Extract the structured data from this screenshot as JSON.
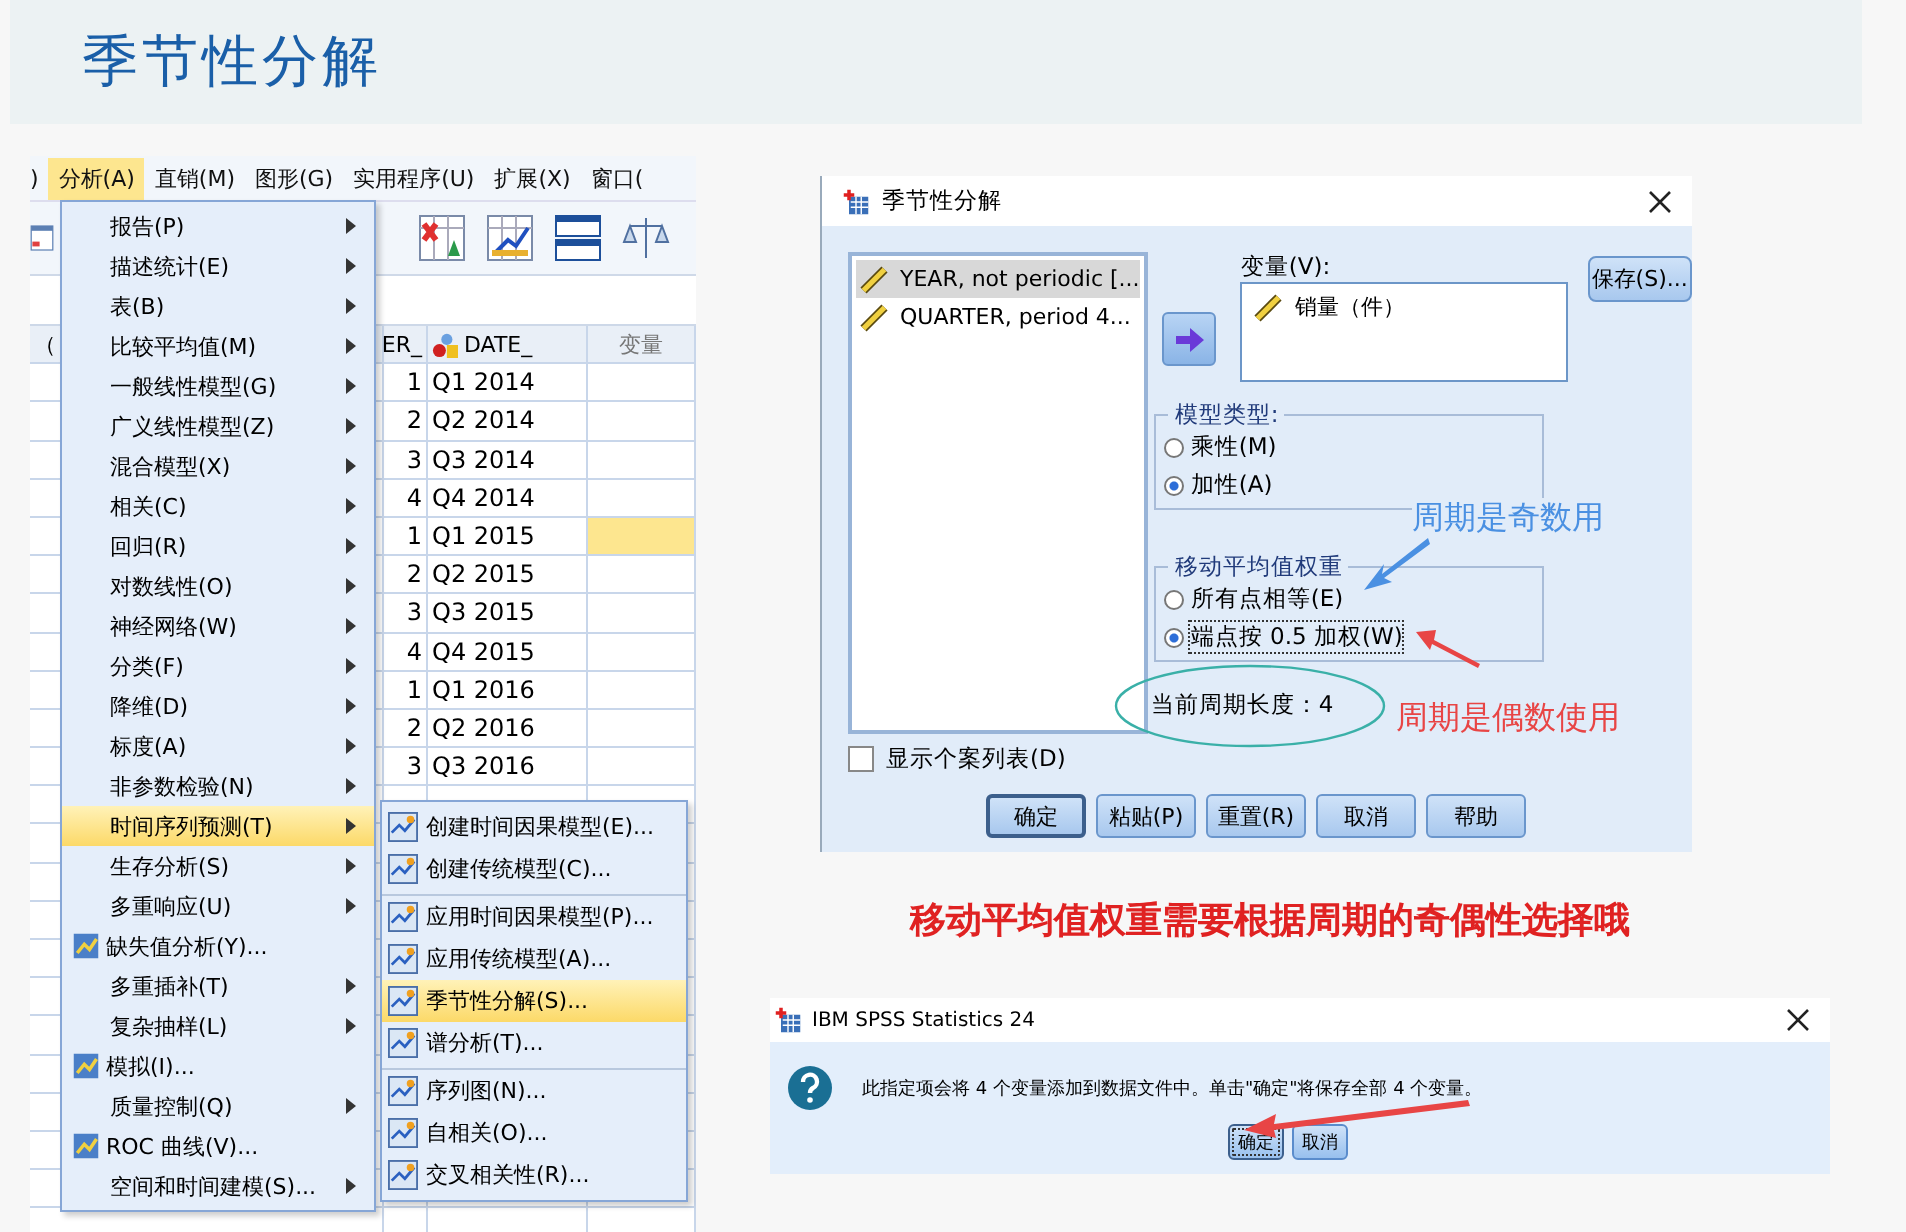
{
  "page": {
    "title": "季节性分解"
  },
  "spss": {
    "menu_bar": [
      {
        "label": ")",
        "selected": false
      },
      {
        "label": "分析(A)",
        "selected": true
      },
      {
        "label": "直销(M)",
        "selected": false
      },
      {
        "label": "图形(G)",
        "selected": false
      },
      {
        "label": "实用程序(U)",
        "selected": false
      },
      {
        "label": "扩展(X)",
        "selected": false
      },
      {
        "label": "窗口(",
        "selected": false
      }
    ],
    "columns": [
      "（",
      "ER_",
      "DATE_",
      "变量"
    ],
    "rows": [
      {
        "period": "1",
        "date": "Q1 2014",
        "selected": false
      },
      {
        "period": "2",
        "date": "Q2 2014",
        "selected": false
      },
      {
        "period": "3",
        "date": "Q3 2014",
        "selected": false
      },
      {
        "period": "4",
        "date": "Q4 2014",
        "selected": false
      },
      {
        "period": "1",
        "date": "Q1 2015",
        "selected": true
      },
      {
        "period": "2",
        "date": "Q2 2015",
        "selected": false
      },
      {
        "period": "3",
        "date": "Q3 2015",
        "selected": false
      },
      {
        "period": "4",
        "date": "Q4 2015",
        "selected": false
      },
      {
        "period": "1",
        "date": "Q1 2016",
        "selected": false
      },
      {
        "period": "2",
        "date": "Q2 2016",
        "selected": false
      },
      {
        "period": "3",
        "date": "Q3 2016",
        "selected": false
      }
    ],
    "analyze_menu": [
      {
        "label": "报告(P)",
        "kind": "submenu",
        "selected": false
      },
      {
        "label": "描述统计(E)",
        "kind": "submenu",
        "selected": false
      },
      {
        "label": "表(B)",
        "kind": "submenu",
        "selected": false
      },
      {
        "label": "比较平均值(M)",
        "kind": "submenu",
        "selected": false
      },
      {
        "label": "一般线性模型(G)",
        "kind": "submenu",
        "selected": false
      },
      {
        "label": "广义线性模型(Z)",
        "kind": "submenu",
        "selected": false
      },
      {
        "label": "混合模型(X)",
        "kind": "submenu",
        "selected": false
      },
      {
        "label": "相关(C)",
        "kind": "submenu",
        "selected": false
      },
      {
        "label": "回归(R)",
        "kind": "submenu",
        "selected": false
      },
      {
        "label": "对数线性(O)",
        "kind": "submenu",
        "selected": false
      },
      {
        "label": "神经网络(W)",
        "kind": "submenu",
        "selected": false
      },
      {
        "label": "分类(F)",
        "kind": "submenu",
        "selected": false
      },
      {
        "label": "降维(D)",
        "kind": "submenu",
        "selected": false
      },
      {
        "label": "标度(A)",
        "kind": "submenu",
        "selected": false
      },
      {
        "label": "非参数检验(N)",
        "kind": "submenu",
        "selected": false
      },
      {
        "label": "时间序列预测(T)",
        "kind": "submenu",
        "selected": true
      },
      {
        "label": "生存分析(S)",
        "kind": "submenu",
        "selected": false
      },
      {
        "label": "多重响应(U)",
        "kind": "submenu",
        "selected": false
      },
      {
        "label": "缺失值分析(Y)...",
        "kind": "action",
        "selected": false
      },
      {
        "label": "多重插补(T)",
        "kind": "submenu",
        "selected": false
      },
      {
        "label": "复杂抽样(L)",
        "kind": "submenu",
        "selected": false
      },
      {
        "label": "模拟(I)...",
        "kind": "action",
        "selected": false
      },
      {
        "label": "质量控制(Q)",
        "kind": "submenu",
        "selected": false
      },
      {
        "label": "ROC 曲线(V)...",
        "kind": "action",
        "selected": false
      },
      {
        "label": "空间和时间建模(S)...",
        "kind": "submenu",
        "selected": false
      }
    ],
    "time_series_menu": [
      {
        "label": "创建时间因果模型(E)...",
        "selected": false,
        "separator_before": false
      },
      {
        "label": "创建传统模型(C)...",
        "selected": false,
        "separator_before": false
      },
      {
        "label": "应用时间因果模型(P)...",
        "selected": false,
        "separator_before": true
      },
      {
        "label": "应用传统模型(A)...",
        "selected": false,
        "separator_before": false
      },
      {
        "label": "季节性分解(S)...",
        "selected": true,
        "separator_before": false
      },
      {
        "label": "谱分析(T)...",
        "selected": false,
        "separator_before": false
      },
      {
        "label": "序列图(N)...",
        "selected": false,
        "separator_before": true
      },
      {
        "label": "自相关(O)...",
        "selected": false,
        "separator_before": false
      },
      {
        "label": "交叉相关性(R)...",
        "selected": false,
        "separator_before": false
      }
    ]
  },
  "dialog": {
    "title": "季节性分解",
    "source_list": [
      {
        "label": "YEAR, not periodic [...",
        "selected": true
      },
      {
        "label": "QUARTER, period 4...",
        "selected": false
      }
    ],
    "variables_label": "变量(V):",
    "variables": [
      "销量（件）"
    ],
    "save_button": "保存(S)...",
    "model_type": {
      "title": "模型类型:",
      "options": [
        {
          "label": "乘性(M)",
          "selected": false
        },
        {
          "label": "加性(A)",
          "selected": true
        }
      ]
    },
    "moving_average": {
      "title": "移动平均值权重",
      "options": [
        {
          "label": "所有点相等(E)",
          "selected": false
        },
        {
          "label": "端点按 0.5 加权(W)",
          "selected": true
        }
      ]
    },
    "period_label": "当前周期长度：4",
    "show_cases": {
      "label": "显示个案列表(D)",
      "checked": false
    },
    "buttons": [
      {
        "label": "确定",
        "default": true
      },
      {
        "label": "粘贴(P)",
        "default": false
      },
      {
        "label": "重置(R)",
        "default": false
      },
      {
        "label": "取消",
        "default": false
      },
      {
        "label": "帮助",
        "default": false
      }
    ],
    "annotations": [
      {
        "text": "周期是奇数用",
        "color": "#4a90e2"
      },
      {
        "text": "周期是偶数使用",
        "color": "#e84545"
      }
    ]
  },
  "caption": "移动平均值权重需要根据周期的奇偶性选择哦",
  "message_box": {
    "title": "IBM SPSS Statistics 24",
    "message": "此指定项会将 4 个变量添加到数据文件中。单击\"确定\"将保存全部 4 个变量。",
    "buttons": [
      {
        "label": "确定",
        "default": true
      },
      {
        "label": "取消",
        "default": false
      }
    ]
  }
}
